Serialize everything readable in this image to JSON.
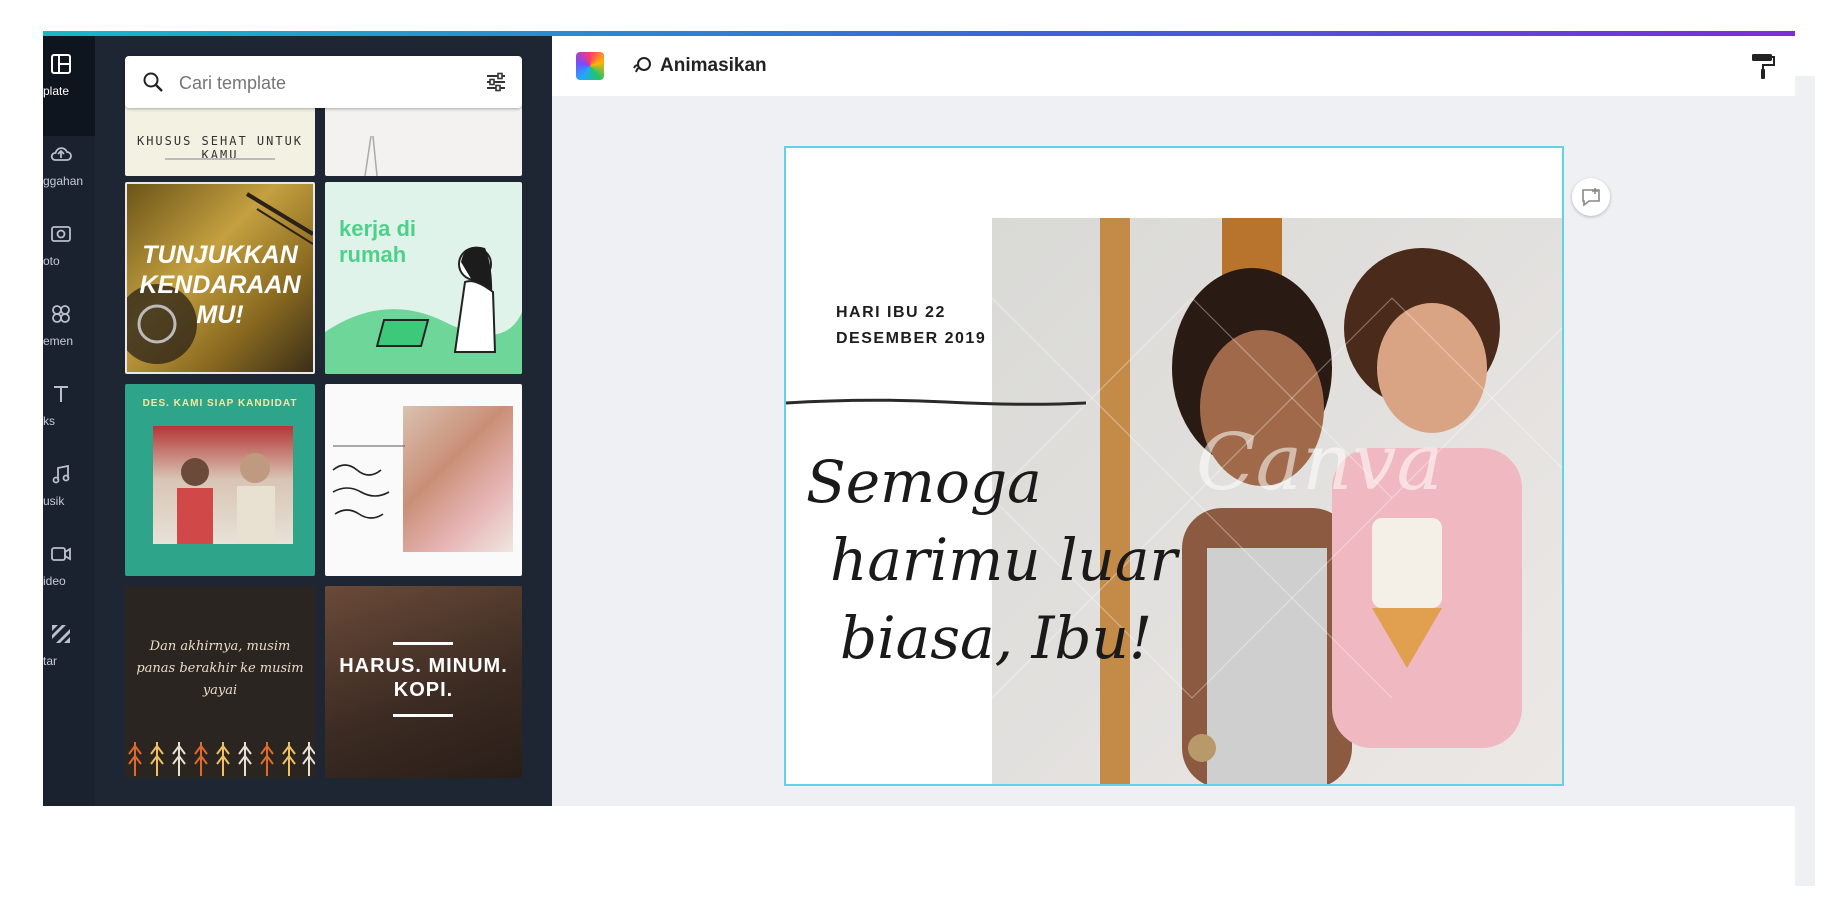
{
  "rail": {
    "items": [
      {
        "label": "plate",
        "icon": "layout-icon"
      },
      {
        "label": "ggahan",
        "icon": "upload-icon"
      },
      {
        "label": "oto",
        "icon": "photo-icon"
      },
      {
        "label": "emen",
        "icon": "elements-icon"
      },
      {
        "label": "ks",
        "icon": "text-icon"
      },
      {
        "label": "usik",
        "icon": "music-icon"
      },
      {
        "label": "ideo",
        "icon": "video-icon"
      },
      {
        "label": "tar",
        "icon": "background-icon"
      }
    ]
  },
  "search": {
    "placeholder": "Cari template"
  },
  "templates": {
    "t0a": "KHUSUS SEHAT UNTUK KAMU",
    "t1": "TUNJUKKAN KENDARAAN MU!",
    "t2": "kerja di rumah",
    "t3": "DES. KAMI SIAP KANDIDAT",
    "t5": "Dan akhirnya, musim panas berakhir ke musim yayai",
    "t6": "HARUS. MINUM. KOPI."
  },
  "toolbar": {
    "animate_label": "Animasikan"
  },
  "design": {
    "date_text": "HARI IBU 22\nDESEMBER 2019",
    "script_line1": "Semoga",
    "script_line2": "harimu luar",
    "script_line3": "biasa, Ibu!",
    "watermark": "Canva"
  },
  "colors": {
    "accent": "#64d2e6",
    "panel": "#1e2633",
    "rail": "#0f151e"
  }
}
